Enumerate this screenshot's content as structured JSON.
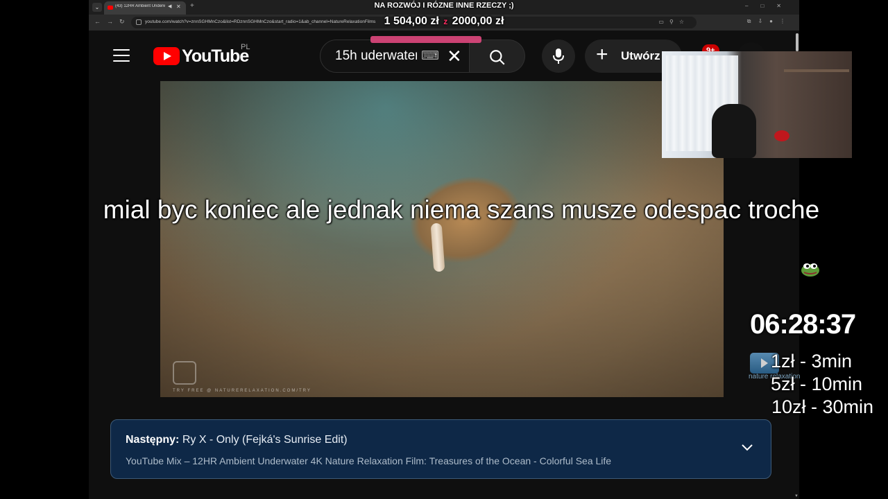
{
  "browser": {
    "tab": {
      "title": "(43) 12HR Ambient Underwater 4K Nature Relaxation Film"
    },
    "address_bar": {
      "url": "youtube.com/watch?v=znnSGHMnCzo&list=RDznnSGHMnCzo&start_radio=1&ab_channel=NatureRelaxationFilms"
    }
  },
  "youtube": {
    "logo_text": "YouTube",
    "region": "PL",
    "search": {
      "query": "15h uderwater"
    },
    "create_label": "Utwórz",
    "notifications_badge": "9+",
    "up_next": {
      "label": "Następny:",
      "title": "Ry X - Only (Fejká's Sunrise Edit)",
      "playlist": "YouTube Mix – 12HR Ambient Underwater 4K Nature Relaxation Film: Treasures of the Ocean - Colorful Sea Life"
    },
    "video": {
      "watermark": "TRY FREE @ NATURERELAXATION.COM/TRY"
    }
  },
  "overlay": {
    "goal": {
      "title": "NA ROZWÓJ I RÓZNE INNE RZECZY ;)",
      "current": "1 504,00 zł",
      "separator": "z",
      "target": "2000,00 zł",
      "fraction": 0.752
    },
    "caption": "mial byc koniec ale jednak niema szans musze odespac troche",
    "timer": "06:28:37",
    "brand_text": "nature relaxation",
    "prices": [
      "1zł - 3min",
      "5zł - 10min",
      "10zł - 30min"
    ]
  },
  "colors": {
    "youtube_red": "#ff0000",
    "up_next_bg": "#0e2847",
    "goal_accent": "#e0487e"
  },
  "icons": [
    "menu-icon",
    "keyboard-icon",
    "clear-icon",
    "search-icon",
    "mic-icon",
    "plus-icon",
    "bell-icon",
    "chevron-down-icon"
  ]
}
